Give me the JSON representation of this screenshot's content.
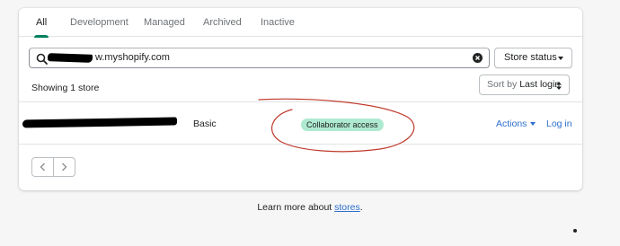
{
  "tabs": [
    {
      "label": "All",
      "active": true
    },
    {
      "label": "Development",
      "active": false
    },
    {
      "label": "Managed",
      "active": false
    },
    {
      "label": "Archived",
      "active": false
    },
    {
      "label": "Inactive",
      "active": false
    }
  ],
  "search": {
    "value": "w.myshopify.com",
    "icon": "search-icon",
    "clear_icon": "clear-icon"
  },
  "filters": {
    "store_status_label": "Store status"
  },
  "summary": {
    "showing_text": "Showing 1 store"
  },
  "sort": {
    "prefix": "Sort by",
    "value": "Last login"
  },
  "store_row": {
    "plan": "Basic",
    "access_badge": "Collaborator access",
    "actions_label": "Actions",
    "login_label": "Log in"
  },
  "pagination": {
    "prev_icon": "chevron-left-icon",
    "next_icon": "chevron-right-icon"
  },
  "footer": {
    "text": "Learn more about",
    "link": "stores",
    "suffix": "."
  },
  "colors": {
    "active_tab_underline": "#008060",
    "link": "#2c6ecb",
    "badge_bg": "#aee9d1",
    "annotation": "#c0392b",
    "redaction": "#000000"
  }
}
